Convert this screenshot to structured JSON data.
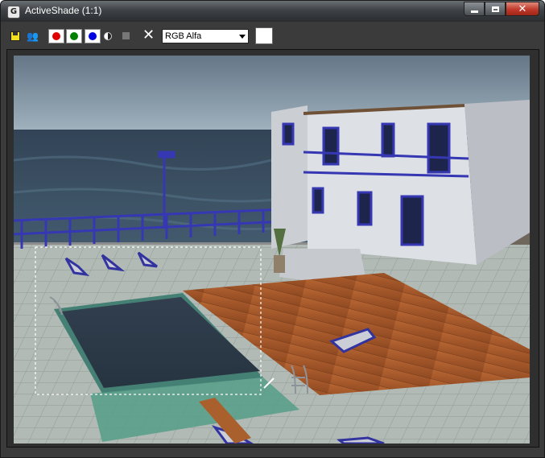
{
  "window": {
    "title": "ActiveShade (1:1)",
    "app_icon_glyph": "G"
  },
  "toolbar": {
    "people_glyph": "👥",
    "clear_glyph": "✕",
    "channel_value": "RGB Alfa",
    "channel_options": [
      "RGB Alfa"
    ]
  },
  "colors": {
    "red_channel": "#e00000",
    "green_channel": "#008000",
    "blue_channel": "#0000e0",
    "title_bar": "#3e4246",
    "close_button": "#c0392b"
  },
  "icons": [
    "app-icon",
    "minimize-icon",
    "maximize-icon",
    "close-icon",
    "save-icon",
    "clone-icon",
    "contrast-icon",
    "stop-icon",
    "clear-icon",
    "dropdown-arrow-icon"
  ]
}
